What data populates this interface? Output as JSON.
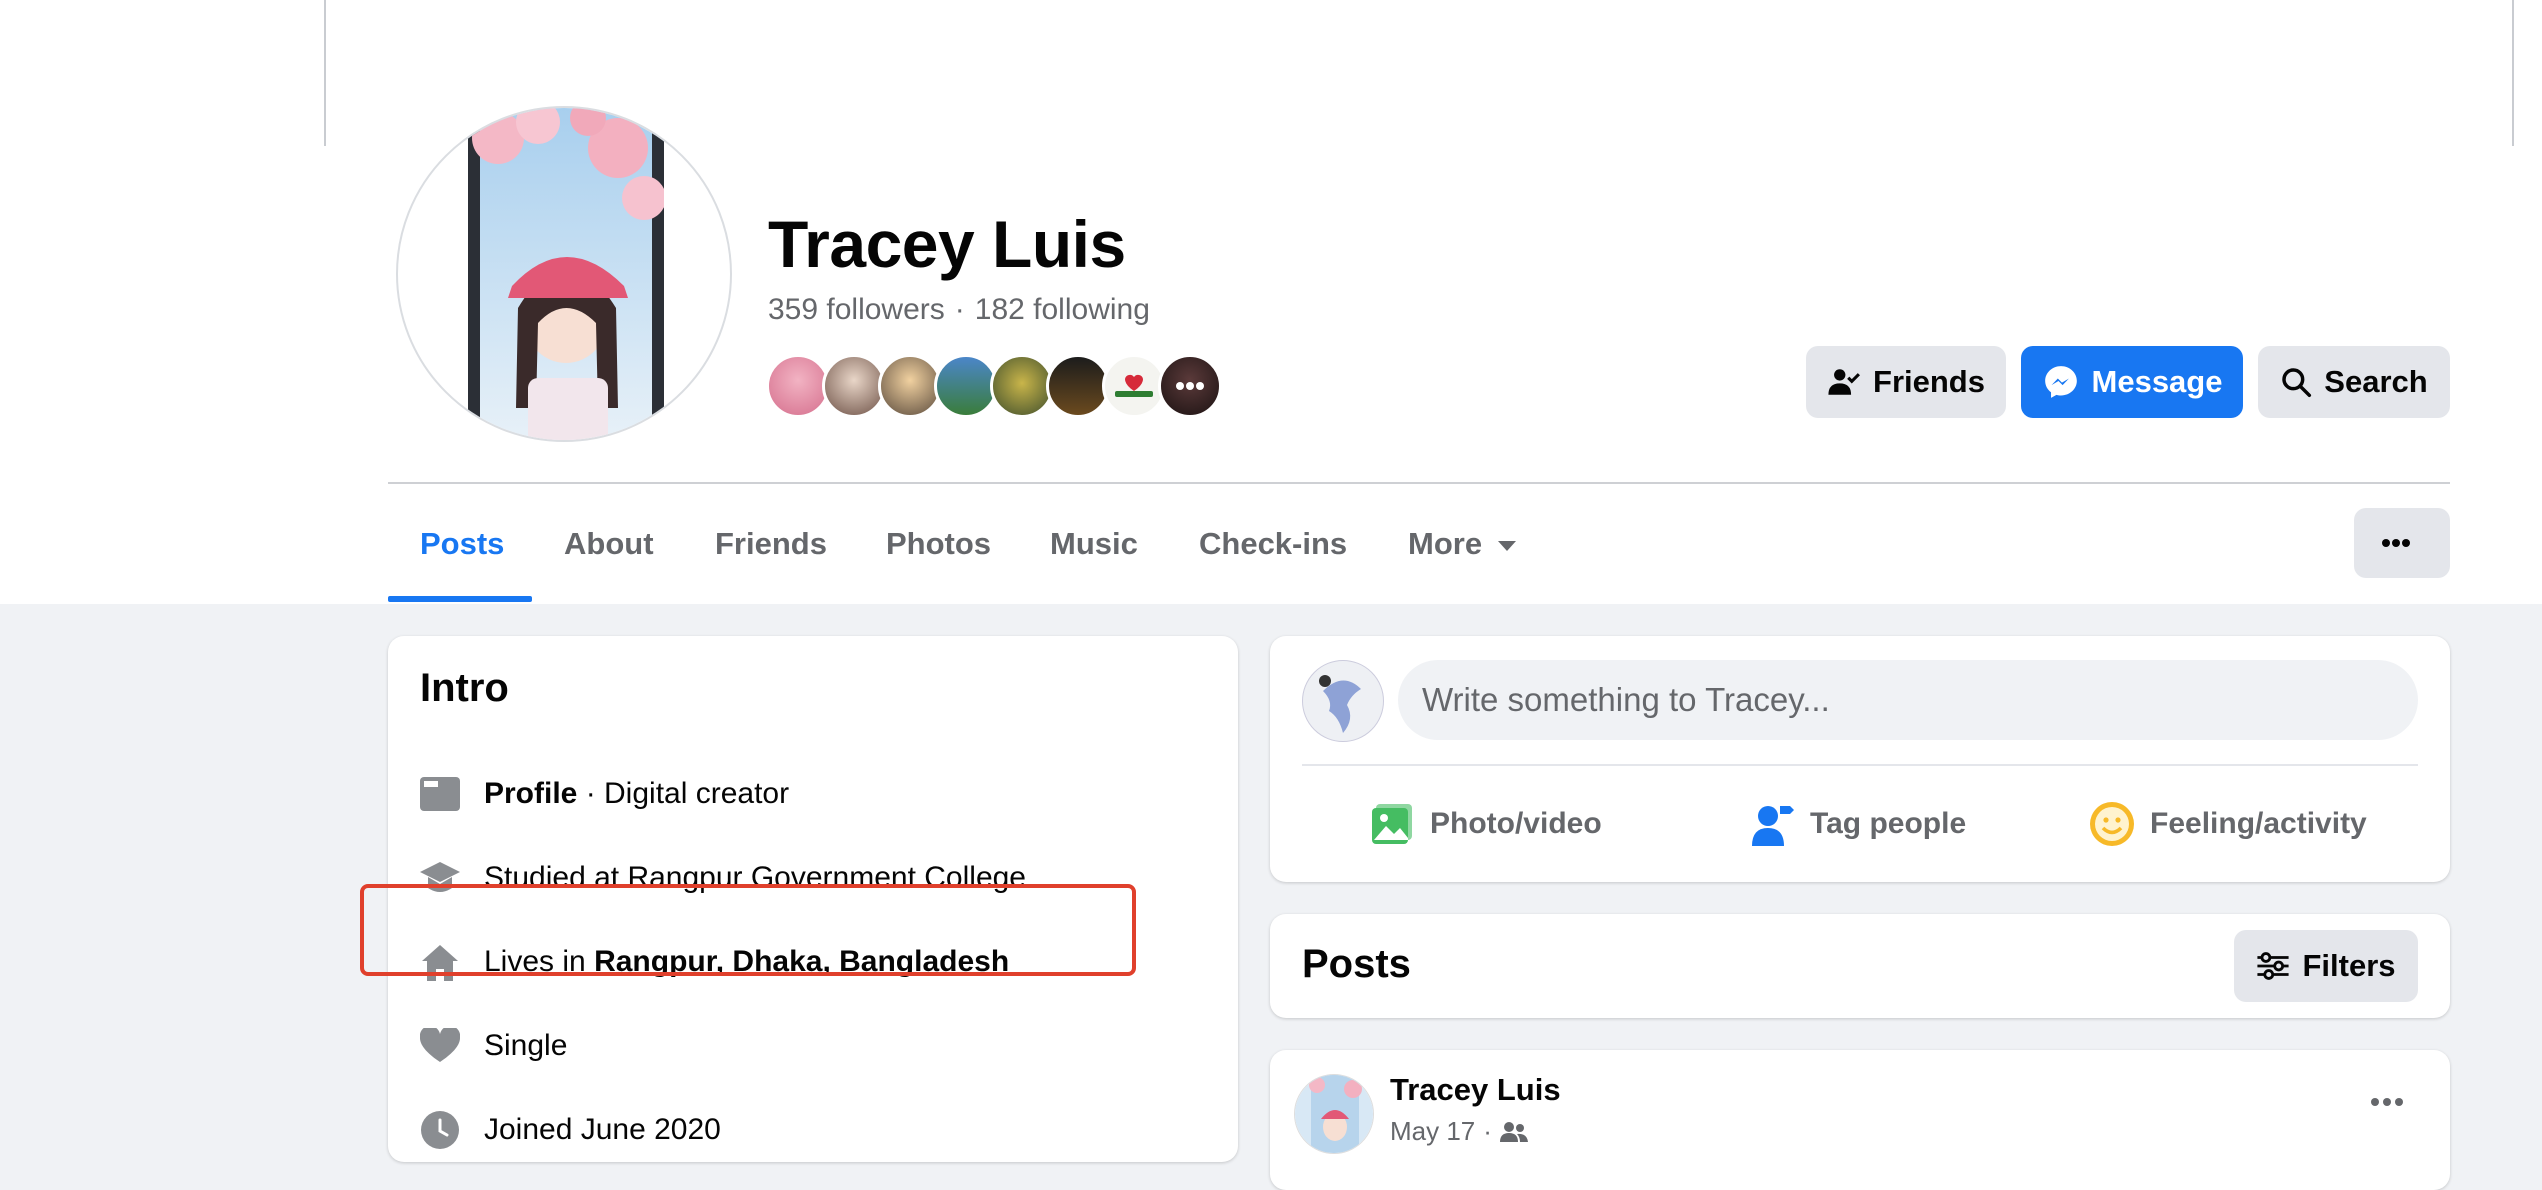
{
  "profile": {
    "name": "Tracey Luis",
    "followers": "359 followers",
    "following": "182 following",
    "stats_separator": "·"
  },
  "actions": {
    "friends": "Friends",
    "message": "Message",
    "search": "Search"
  },
  "tabs": [
    "Posts",
    "About",
    "Friends",
    "Photos",
    "Music",
    "Check-ins",
    "More"
  ],
  "intro": {
    "title": "Intro",
    "profile_label": "Profile",
    "profile_value": " · Digital creator",
    "studied": "Studied at Rangpur Government College",
    "lives_prefix": "Lives in ",
    "lives_place": "Rangpur, Dhaka, Bangladesh",
    "relationship": "Single",
    "joined": "Joined June 2020"
  },
  "composer": {
    "placeholder": "Write something to Tracey...",
    "photo_video": "Photo/video",
    "tag_people": "Tag people",
    "feeling": "Feeling/activity"
  },
  "posts": {
    "title": "Posts",
    "filters": "Filters"
  },
  "post": {
    "author": "Tracey Luis",
    "date": "May 17",
    "separator": "·"
  },
  "colors": {
    "accent": "#1877f2",
    "highlight_box": "#e0402c",
    "secondary_text": "#65676b"
  }
}
